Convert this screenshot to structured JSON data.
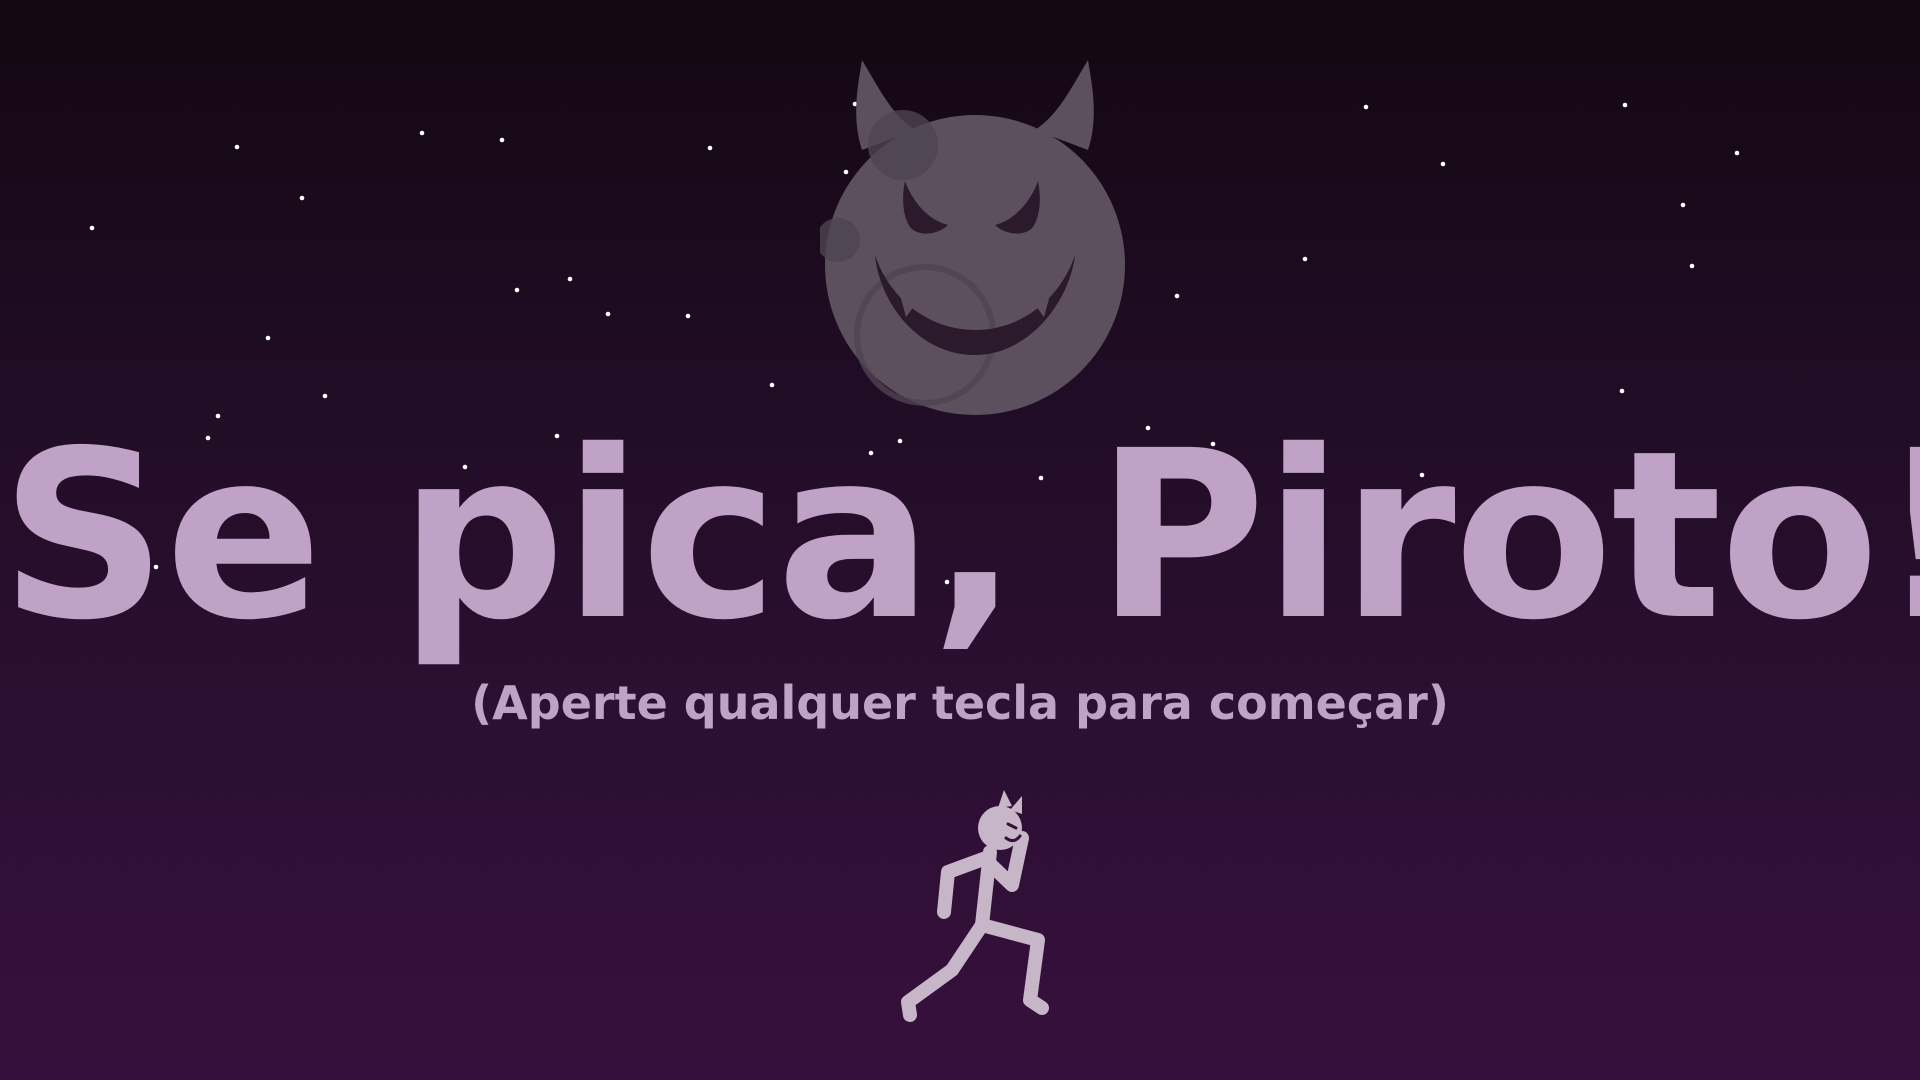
{
  "screen": "title-screen",
  "title": "Se pica, Piroto!",
  "subtitle": "(Aperte qualquer tecla para começar)",
  "colors": {
    "background_top": "#130712",
    "background_bottom": "#36103c",
    "text": "#c0a2c6",
    "moon": "#5c4f5e",
    "moon_features": "#2a1a2c",
    "stars": "#ffffff",
    "runner": "#c7b6c8"
  },
  "icons": {
    "moon": "devil-moon-icon",
    "player": "running-devil-stickman-icon"
  }
}
